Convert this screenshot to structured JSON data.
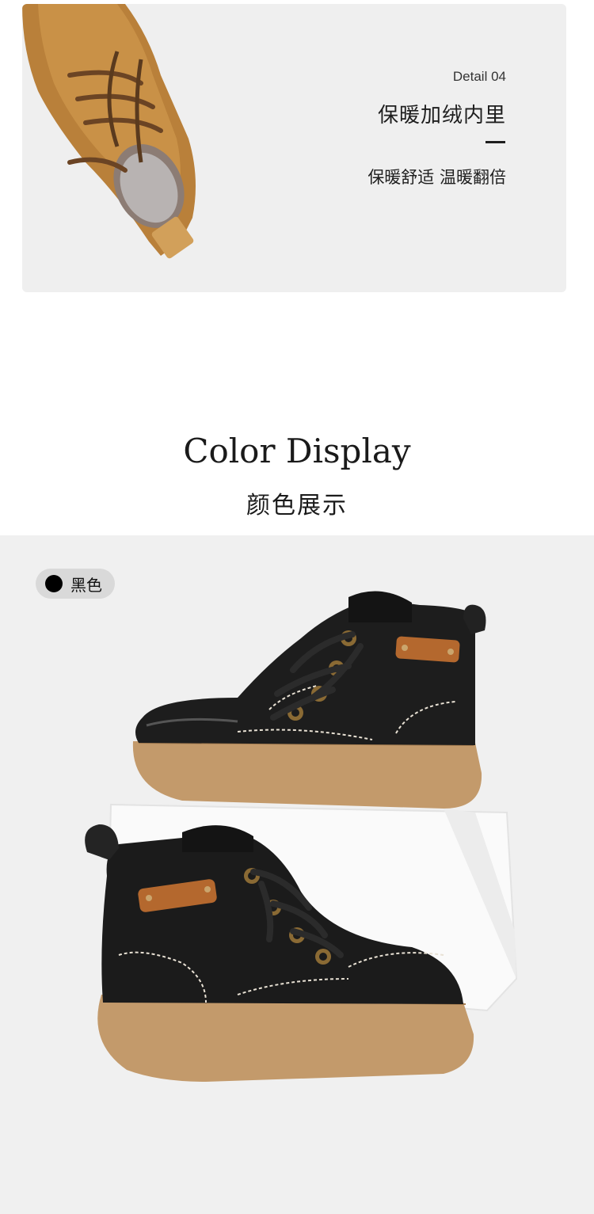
{
  "detail": {
    "label": "Detail 04",
    "title": "保暖加绒内里",
    "subtitle": "保暖舒适 温暖翻倍"
  },
  "color_section": {
    "heading": "Color Display",
    "subheading": "颜色展示"
  },
  "color_option": {
    "name": "黑色",
    "swatch": "#000000"
  },
  "colors": {
    "card_bg": "#efefef",
    "product_bg": "#f0f0f0",
    "boot_tan": "#c28a3c",
    "boot_black": "#1c1c1c",
    "sole": "#c39a6b"
  }
}
